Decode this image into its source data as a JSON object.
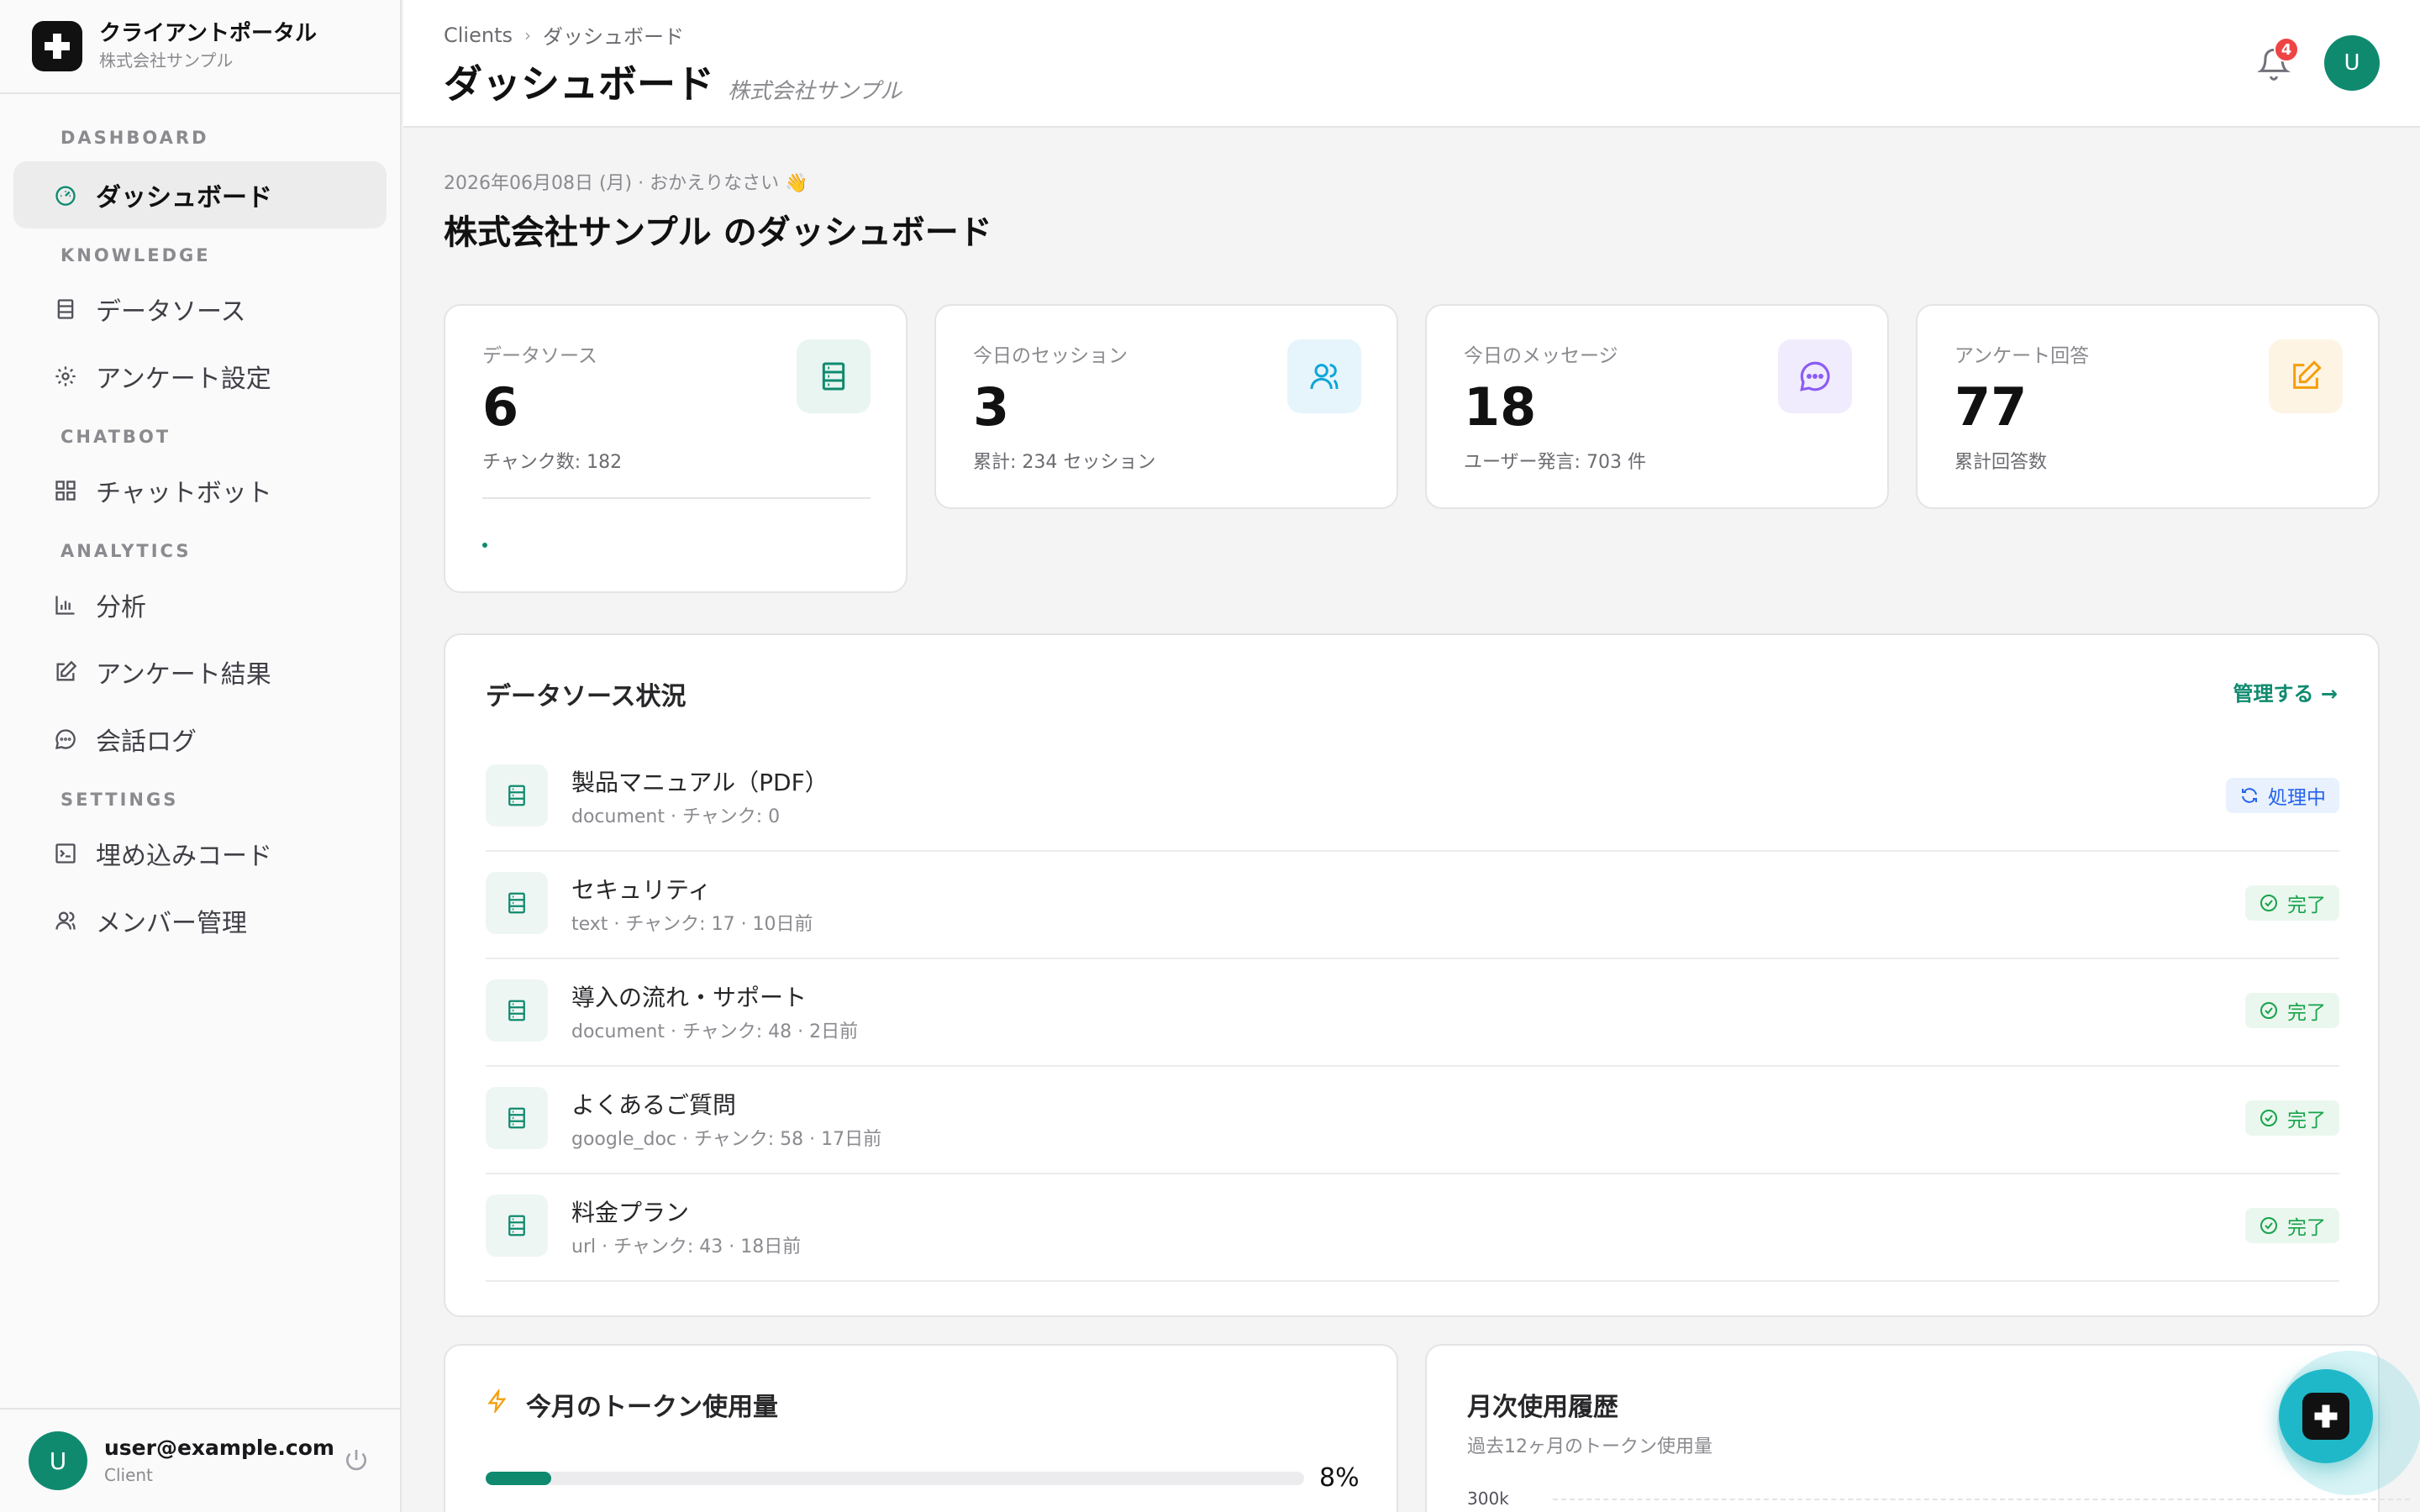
{
  "brand": {
    "title": "クライアントポータル",
    "subtitle": "株式会社サンプル"
  },
  "sidebar": {
    "sections": [
      {
        "label": "DASHBOARD"
      },
      {
        "label": "KNOWLEDGE"
      },
      {
        "label": "CHATBOT"
      },
      {
        "label": "ANALYTICS"
      },
      {
        "label": "SETTINGS"
      }
    ],
    "items": [
      {
        "label": "ダッシュボード",
        "icon": "gauge-icon",
        "active": true
      },
      {
        "label": "データソース",
        "icon": "database-icon"
      },
      {
        "label": "アンケート設定",
        "icon": "gear-icon"
      },
      {
        "label": "チャットボット",
        "icon": "grid-icon"
      },
      {
        "label": "分析",
        "icon": "bar-chart-icon"
      },
      {
        "label": "アンケート結果",
        "icon": "edit-icon"
      },
      {
        "label": "会話ログ",
        "icon": "chat-bubble-icon"
      },
      {
        "label": "埋め込みコード",
        "icon": "terminal-icon"
      },
      {
        "label": "メンバー管理",
        "icon": "users-icon"
      }
    ]
  },
  "user": {
    "initial": "U",
    "email": "user@example.com",
    "role": "Client"
  },
  "header": {
    "breadcrumb": [
      "Clients",
      "ダッシュボード"
    ],
    "title": "ダッシュボード",
    "subtitle": "株式会社サンプル",
    "notification_count": "4",
    "avatar_initial": "U"
  },
  "main": {
    "greeting": "2026年06月08日 (月) · おかえりなさい 👋",
    "heading": "株式会社サンプル のダッシュボード"
  },
  "stats": [
    {
      "label": "データソース",
      "value": "6",
      "sub": "チャンク数: 182",
      "icon": "database-icon",
      "color": "#0f8a6f",
      "bg": "#e9f5f1"
    },
    {
      "label": "今日のセッション",
      "value": "3",
      "sub": "累計: 234 セッション",
      "icon": "users-icon",
      "color": "#0ea5d9",
      "bg": "#e6f5fb"
    },
    {
      "label": "今日のメッセージ",
      "value": "18",
      "sub": "ユーザー発言: 703 件",
      "icon": "chat-bubble-icon",
      "color": "#8b5cf6",
      "bg": "#f1ecfd"
    },
    {
      "label": "アンケート回答",
      "value": "77",
      "sub": "累計回答数",
      "icon": "edit-icon",
      "color": "#f59e0b",
      "bg": "#fdf4e4"
    }
  ],
  "datasources": {
    "title": "データソース状況",
    "manage_label": "管理する →",
    "rows": [
      {
        "name": "製品マニュアル（PDF）",
        "meta": "document · チャンク: 0",
        "status": "処理中",
        "status_type": "processing"
      },
      {
        "name": "セキュリティ",
        "meta": "text · チャンク: 17 · 10日前",
        "status": "完了",
        "status_type": "done"
      },
      {
        "name": "導入の流れ・サポート",
        "meta": "document · チャンク: 48 · 2日前",
        "status": "完了",
        "status_type": "done"
      },
      {
        "name": "よくあるご質問",
        "meta": "google_doc · チャンク: 58 · 17日前",
        "status": "完了",
        "status_type": "done"
      },
      {
        "name": "料金プラン",
        "meta": "url · チャンク: 43 · 18日前",
        "status": "完了",
        "status_type": "done"
      }
    ]
  },
  "tokens": {
    "title": "今月のトークン使用量",
    "percent_label": "8%",
    "percent": 0.08
  },
  "history": {
    "title": "月次使用履歴",
    "subtitle": "過去12ヶ月のトークン使用量",
    "axis_top": "300k"
  }
}
